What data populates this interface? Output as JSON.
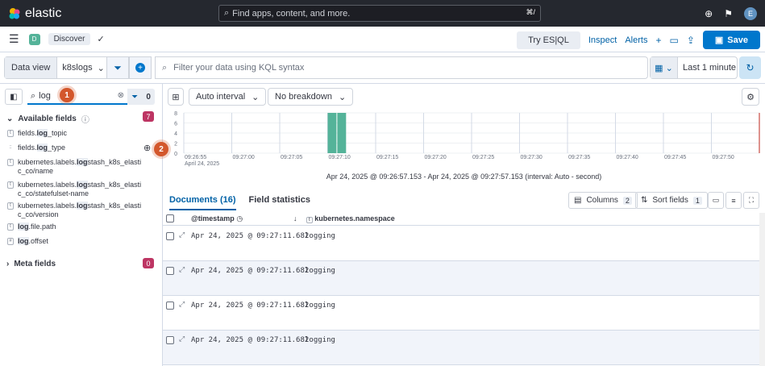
{
  "topbar": {
    "brand": "elastic",
    "search_placeholder": "Find apps, content, and more.",
    "shortcut": "⌘/",
    "avatar": "E"
  },
  "header": {
    "app_badge": "D",
    "breadcrumb": "Discover",
    "try_esql": "Try ES|QL",
    "inspect": "Inspect",
    "alerts": "Alerts",
    "save": "Save"
  },
  "query": {
    "data_view_label": "Data view",
    "data_view_value": "k8slogs",
    "kql_placeholder": "Filter your data using KQL syntax",
    "time_range": "Last 1 minute"
  },
  "sidebar": {
    "search_value": "log",
    "filter_count": "0",
    "available_label": "Available fields",
    "available_count": "7",
    "meta_label": "Meta fields",
    "meta_count": "0",
    "fields": [
      {
        "type": "t",
        "pre": "fields.",
        "hl": "log",
        "post": "_topic"
      },
      {
        "type": "::",
        "pre": "fields.",
        "hl": "log",
        "post": "_type"
      },
      {
        "type": "t",
        "pre": "kubernetes.labels.",
        "hl": "log",
        "post": "stash_k8s_elastic_co/name"
      },
      {
        "type": "t",
        "pre": "kubernetes.labels.",
        "hl": "log",
        "post": "stash_k8s_elastic_co/statefulset-name"
      },
      {
        "type": "t",
        "pre": "kubernetes.labels.",
        "hl": "log",
        "post": "stash_k8s_elastic_co/version"
      },
      {
        "type": "t",
        "pre": "",
        "hl": "log",
        "post": ".file.path"
      },
      {
        "type": "#",
        "pre": "",
        "hl": "log",
        "post": ".offset"
      }
    ],
    "steps": [
      "1",
      "2"
    ]
  },
  "chart_controls": {
    "interval": "Auto interval",
    "breakdown": "No breakdown"
  },
  "chart_data": {
    "type": "bar",
    "y_ticks": [
      "8",
      "6",
      "4",
      "2",
      "0"
    ],
    "ylim": [
      0,
      8
    ],
    "x_ticks": [
      "09:26:55",
      "09:27:00",
      "09:27:05",
      "09:27:10",
      "09:27:15",
      "09:27:20",
      "09:27:25",
      "09:27:30",
      "09:27:35",
      "09:27:40",
      "09:27:45",
      "09:27:50"
    ],
    "x_date": "April 24, 2025",
    "bars": [
      {
        "x": "09:27:10",
        "value": 8
      },
      {
        "x": "09:27:11",
        "value": 8
      }
    ],
    "color": "#54b399"
  },
  "time_status": "Apr 24, 2025 @ 09:26:57.153 - Apr 24, 2025 @ 09:27:57.153 (interval: Auto - second)",
  "docs": {
    "tab_documents": "Documents (16)",
    "tab_fieldstats": "Field statistics",
    "columns_label": "Columns",
    "columns_count": "2",
    "sort_label": "Sort fields",
    "sort_count": "1",
    "col_timestamp": "@timestamp",
    "col_ns": "kubernetes.namespace",
    "rows": [
      {
        "ts": "Apr 24, 2025 @ 09:27:11.682",
        "ns": "logging"
      },
      {
        "ts": "Apr 24, 2025 @ 09:27:11.682",
        "ns": "logging"
      },
      {
        "ts": "Apr 24, 2025 @ 09:27:11.682",
        "ns": "logging"
      },
      {
        "ts": "Apr 24, 2025 @ 09:27:11.682",
        "ns": "logging"
      }
    ]
  }
}
